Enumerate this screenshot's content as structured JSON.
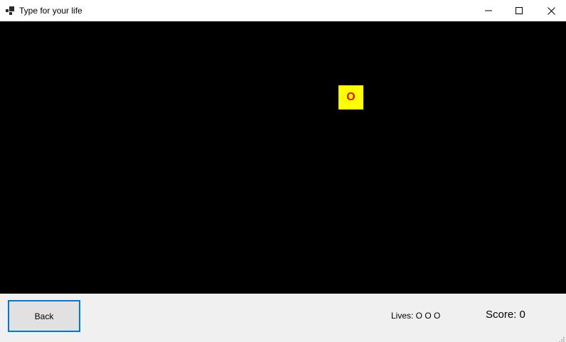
{
  "window": {
    "title": "Type for your life",
    "icons": {
      "app": "app-icon",
      "minimize": "minimize-icon",
      "maximize": "maximize-icon",
      "close": "close-icon"
    }
  },
  "game": {
    "background_color": "#000000",
    "falling_letters": [
      {
        "char": "O",
        "background_color": "#ffff00",
        "text_color": "#ff0000"
      }
    ]
  },
  "controls": {
    "back_label": "Back"
  },
  "status": {
    "lives_text": "Lives: O O O",
    "score_text": "Score: 0"
  }
}
